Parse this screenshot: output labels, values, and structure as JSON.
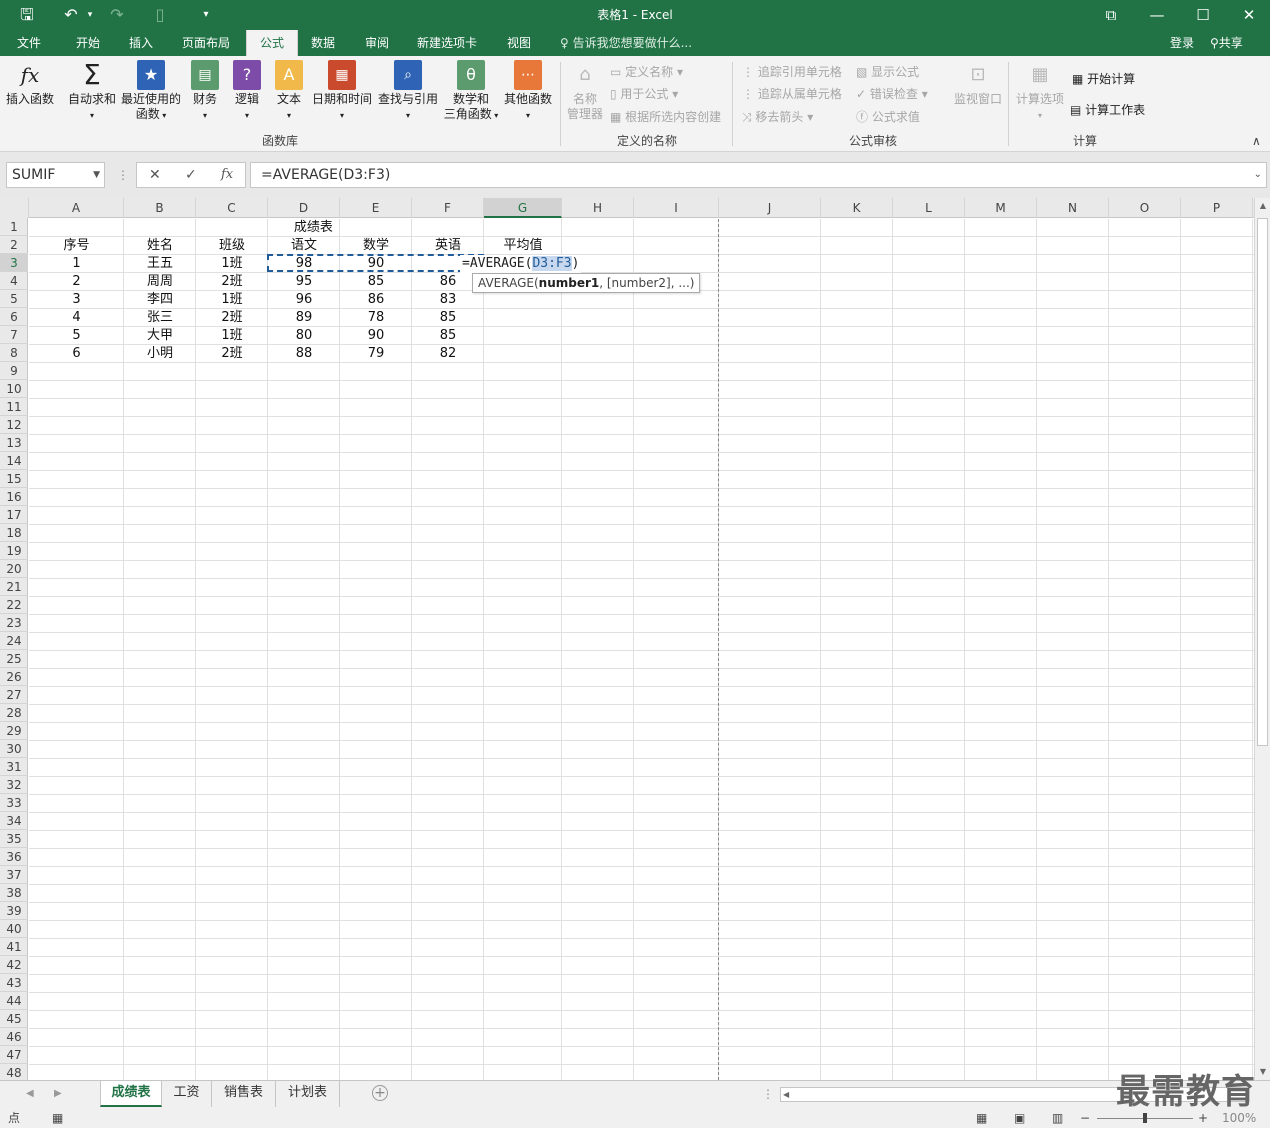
{
  "titlebar": {
    "title": "表格1 - Excel",
    "icons": [
      "save-icon",
      "undo-icon",
      "redo-icon",
      "new-file-icon",
      "customize-icon"
    ],
    "window_controls": [
      "ribbon-display-icon",
      "minimize-icon",
      "maximize-icon",
      "close-icon"
    ]
  },
  "menu": {
    "tabs": [
      "文件",
      "开始",
      "插入",
      "页面布局",
      "公式",
      "数据",
      "审阅",
      "新建选项卡",
      "视图"
    ],
    "active_tab": "公式",
    "tell_me": "告诉我您想要做什么...",
    "login": "登录",
    "share": "共享"
  },
  "ribbon": {
    "library": {
      "label": "函数库",
      "buttons": [
        {
          "label1": "插入函数",
          "label2": ""
        },
        {
          "label1": "自动求和",
          "label2": ""
        },
        {
          "label1": "最近使用的",
          "label2": "函数"
        },
        {
          "label1": "财务",
          "label2": ""
        },
        {
          "label1": "逻辑",
          "label2": ""
        },
        {
          "label1": "文本",
          "label2": ""
        },
        {
          "label1": "日期和时间",
          "label2": ""
        },
        {
          "label1": "查找与引用",
          "label2": ""
        },
        {
          "label1": "数学和",
          "label2": "三角函数"
        },
        {
          "label1": "其他函数",
          "label2": ""
        }
      ]
    },
    "names": {
      "label": "定义的名称",
      "manager_1": "名称",
      "manager_2": "管理器",
      "define": "定义名称",
      "use": "用于公式",
      "create": "根据所选内容创建"
    },
    "audit": {
      "label": "公式审核",
      "trace_prec": "追踪引用单元格",
      "trace_dep": "追踪从属单元格",
      "remove": "移去箭头",
      "show": "显示公式",
      "check": "错误检查",
      "eval": "公式求值",
      "watch": "监视窗口"
    },
    "calc": {
      "label": "计算",
      "options": "计算选项",
      "now": "开始计算",
      "sheet": "计算工作表"
    }
  },
  "formula_bar": {
    "name_box": "SUMIF",
    "cancel": "✕",
    "enter": "✓",
    "fx": "fx",
    "formula": "=AVERAGE(D3:F3)"
  },
  "sheet": {
    "columns": [
      "A",
      "B",
      "C",
      "D",
      "E",
      "F",
      "G",
      "H",
      "I",
      "J",
      "K",
      "L",
      "M",
      "N",
      "O",
      "P"
    ],
    "active_column": "G",
    "active_row": 3,
    "rows": [
      "1",
      "2",
      "3",
      "4",
      "5",
      "6",
      "7",
      "8",
      "9",
      "10",
      "11",
      "12",
      "13",
      "14",
      "15",
      "16",
      "17",
      "18",
      "19",
      "20",
      "21",
      "22",
      "23",
      "24",
      "25",
      "26",
      "27",
      "28",
      "29",
      "30",
      "31",
      "32",
      "33",
      "34",
      "35",
      "36",
      "37",
      "38",
      "39",
      "40",
      "41",
      "42",
      "43",
      "44",
      "45",
      "46",
      "47",
      "48"
    ],
    "title": "成绩表",
    "headers": [
      "序号",
      "姓名",
      "班级",
      "语文",
      "数学",
      "英语",
      "平均值"
    ],
    "data": [
      [
        "1",
        "王五",
        "1班",
        "98",
        "90",
        ""
      ],
      [
        "2",
        "周周",
        "2班",
        "95",
        "85",
        "86"
      ],
      [
        "3",
        "李四",
        "1班",
        "96",
        "86",
        "83"
      ],
      [
        "4",
        "张三",
        "2班",
        "89",
        "78",
        "85"
      ],
      [
        "5",
        "大甲",
        "1班",
        "80",
        "90",
        "85"
      ],
      [
        "6",
        "小明",
        "2班",
        "88",
        "79",
        "82"
      ]
    ],
    "editing": {
      "prefix": "=AVERAGE(",
      "ref": "D3:F3",
      "suffix": ")"
    },
    "tooltip": {
      "fn": "AVERAGE(",
      "arg1": "number1",
      "rest": ", [number2], ...)"
    }
  },
  "sheet_tabs": {
    "tabs": [
      "成绩表",
      "工资",
      "销售表",
      "计划表"
    ],
    "active": "成绩表"
  },
  "status": {
    "mode": "点",
    "zoom": "100%",
    "zoom_minus": "−",
    "zoom_plus": "+"
  },
  "watermark": "最需教育"
}
